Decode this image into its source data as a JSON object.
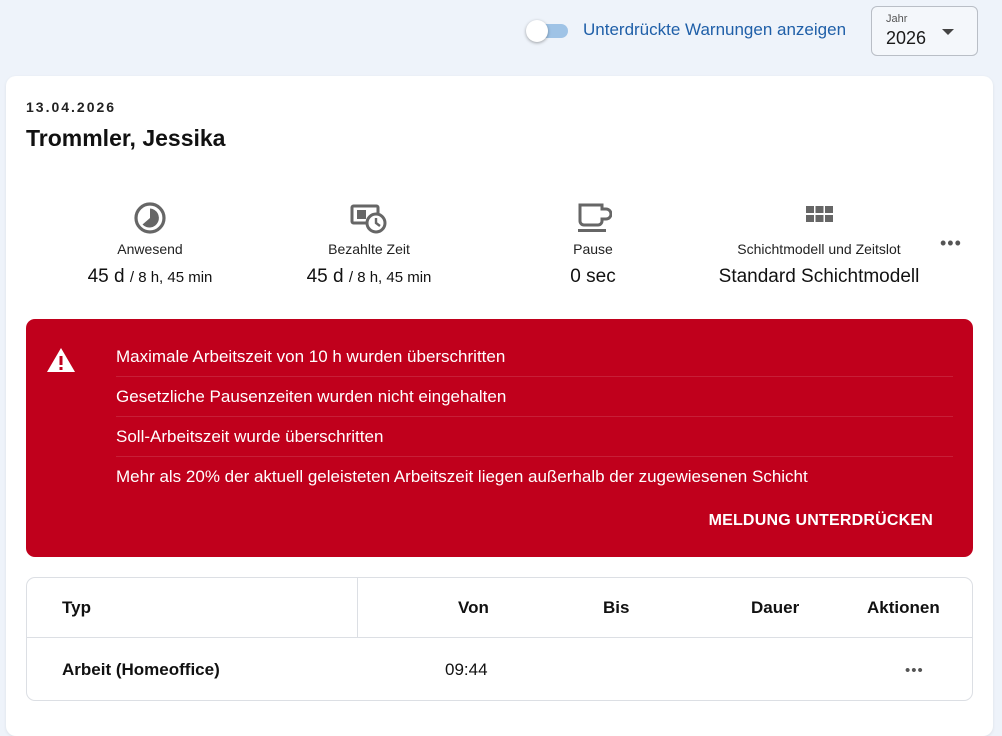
{
  "toolbar": {
    "show_suppressed_label": "Unterdrückte Warnungen anzeigen",
    "show_suppressed_enabled": false,
    "year_caption": "Jahr",
    "year_value": "2026"
  },
  "day": {
    "date": "13.04.2026",
    "employee": "Trommler, Jessika"
  },
  "stats": [
    {
      "icon": "clock-pie-icon",
      "label": "Anwesend",
      "value": "45 d",
      "sub": "/ 8 h, 45 min"
    },
    {
      "icon": "paid-time-icon",
      "label": "Bezahlte Zeit",
      "value": "45 d",
      "sub": "/ 8 h, 45 min"
    },
    {
      "icon": "coffee-cup-icon",
      "label": "Pause",
      "value": "0 sec",
      "sub": ""
    },
    {
      "icon": "grid-icon",
      "label": "Schichtmodell und Zeitslot",
      "value": "Standard Schichtmodell",
      "sub": ""
    }
  ],
  "alert": {
    "icon": "warning-icon",
    "color": "#c0001c",
    "messages": [
      "Maximale Arbeitszeit von 10 h wurden überschritten",
      "Gesetzliche Pausenzeiten wurden nicht eingehalten",
      "Soll-Arbeitszeit wurde überschritten",
      "Mehr als 20% der aktuell geleisteten Arbeitszeit liegen außerhalb der zugewiesenen Schicht"
    ],
    "suppress_label": "MELDUNG UNTERDRÜCKEN"
  },
  "table": {
    "columns": [
      "Typ",
      "Von",
      "Bis",
      "Dauer",
      "Aktionen"
    ],
    "rows": [
      {
        "typ": "Arbeit (Homeoffice)",
        "von": "09:44",
        "bis": "",
        "dauer": "",
        "actions_icon": "more-horizontal-icon"
      }
    ]
  },
  "icons": {
    "more": "more-horizontal-icon",
    "caret": "chevron-down-icon"
  }
}
